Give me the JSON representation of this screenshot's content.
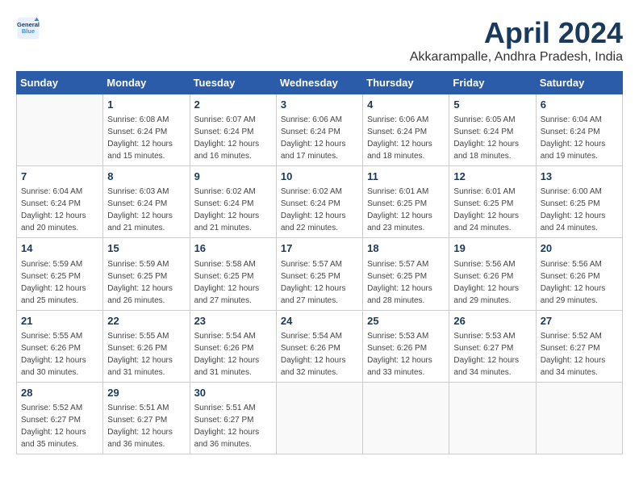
{
  "header": {
    "logo_line1": "General",
    "logo_line2": "Blue",
    "month_title": "April 2024",
    "subtitle": "Akkarampalle, Andhra Pradesh, India"
  },
  "weekdays": [
    "Sunday",
    "Monday",
    "Tuesday",
    "Wednesday",
    "Thursday",
    "Friday",
    "Saturday"
  ],
  "weeks": [
    [
      {
        "day": "",
        "sunrise": "",
        "sunset": "",
        "daylight": ""
      },
      {
        "day": "1",
        "sunrise": "Sunrise: 6:08 AM",
        "sunset": "Sunset: 6:24 PM",
        "daylight": "Daylight: 12 hours and 15 minutes."
      },
      {
        "day": "2",
        "sunrise": "Sunrise: 6:07 AM",
        "sunset": "Sunset: 6:24 PM",
        "daylight": "Daylight: 12 hours and 16 minutes."
      },
      {
        "day": "3",
        "sunrise": "Sunrise: 6:06 AM",
        "sunset": "Sunset: 6:24 PM",
        "daylight": "Daylight: 12 hours and 17 minutes."
      },
      {
        "day": "4",
        "sunrise": "Sunrise: 6:06 AM",
        "sunset": "Sunset: 6:24 PM",
        "daylight": "Daylight: 12 hours and 18 minutes."
      },
      {
        "day": "5",
        "sunrise": "Sunrise: 6:05 AM",
        "sunset": "Sunset: 6:24 PM",
        "daylight": "Daylight: 12 hours and 18 minutes."
      },
      {
        "day": "6",
        "sunrise": "Sunrise: 6:04 AM",
        "sunset": "Sunset: 6:24 PM",
        "daylight": "Daylight: 12 hours and 19 minutes."
      }
    ],
    [
      {
        "day": "7",
        "sunrise": "Sunrise: 6:04 AM",
        "sunset": "Sunset: 6:24 PM",
        "daylight": "Daylight: 12 hours and 20 minutes."
      },
      {
        "day": "8",
        "sunrise": "Sunrise: 6:03 AM",
        "sunset": "Sunset: 6:24 PM",
        "daylight": "Daylight: 12 hours and 21 minutes."
      },
      {
        "day": "9",
        "sunrise": "Sunrise: 6:02 AM",
        "sunset": "Sunset: 6:24 PM",
        "daylight": "Daylight: 12 hours and 21 minutes."
      },
      {
        "day": "10",
        "sunrise": "Sunrise: 6:02 AM",
        "sunset": "Sunset: 6:24 PM",
        "daylight": "Daylight: 12 hours and 22 minutes."
      },
      {
        "day": "11",
        "sunrise": "Sunrise: 6:01 AM",
        "sunset": "Sunset: 6:25 PM",
        "daylight": "Daylight: 12 hours and 23 minutes."
      },
      {
        "day": "12",
        "sunrise": "Sunrise: 6:01 AM",
        "sunset": "Sunset: 6:25 PM",
        "daylight": "Daylight: 12 hours and 24 minutes."
      },
      {
        "day": "13",
        "sunrise": "Sunrise: 6:00 AM",
        "sunset": "Sunset: 6:25 PM",
        "daylight": "Daylight: 12 hours and 24 minutes."
      }
    ],
    [
      {
        "day": "14",
        "sunrise": "Sunrise: 5:59 AM",
        "sunset": "Sunset: 6:25 PM",
        "daylight": "Daylight: 12 hours and 25 minutes."
      },
      {
        "day": "15",
        "sunrise": "Sunrise: 5:59 AM",
        "sunset": "Sunset: 6:25 PM",
        "daylight": "Daylight: 12 hours and 26 minutes."
      },
      {
        "day": "16",
        "sunrise": "Sunrise: 5:58 AM",
        "sunset": "Sunset: 6:25 PM",
        "daylight": "Daylight: 12 hours and 27 minutes."
      },
      {
        "day": "17",
        "sunrise": "Sunrise: 5:57 AM",
        "sunset": "Sunset: 6:25 PM",
        "daylight": "Daylight: 12 hours and 27 minutes."
      },
      {
        "day": "18",
        "sunrise": "Sunrise: 5:57 AM",
        "sunset": "Sunset: 6:25 PM",
        "daylight": "Daylight: 12 hours and 28 minutes."
      },
      {
        "day": "19",
        "sunrise": "Sunrise: 5:56 AM",
        "sunset": "Sunset: 6:26 PM",
        "daylight": "Daylight: 12 hours and 29 minutes."
      },
      {
        "day": "20",
        "sunrise": "Sunrise: 5:56 AM",
        "sunset": "Sunset: 6:26 PM",
        "daylight": "Daylight: 12 hours and 29 minutes."
      }
    ],
    [
      {
        "day": "21",
        "sunrise": "Sunrise: 5:55 AM",
        "sunset": "Sunset: 6:26 PM",
        "daylight": "Daylight: 12 hours and 30 minutes."
      },
      {
        "day": "22",
        "sunrise": "Sunrise: 5:55 AM",
        "sunset": "Sunset: 6:26 PM",
        "daylight": "Daylight: 12 hours and 31 minutes."
      },
      {
        "day": "23",
        "sunrise": "Sunrise: 5:54 AM",
        "sunset": "Sunset: 6:26 PM",
        "daylight": "Daylight: 12 hours and 31 minutes."
      },
      {
        "day": "24",
        "sunrise": "Sunrise: 5:54 AM",
        "sunset": "Sunset: 6:26 PM",
        "daylight": "Daylight: 12 hours and 32 minutes."
      },
      {
        "day": "25",
        "sunrise": "Sunrise: 5:53 AM",
        "sunset": "Sunset: 6:26 PM",
        "daylight": "Daylight: 12 hours and 33 minutes."
      },
      {
        "day": "26",
        "sunrise": "Sunrise: 5:53 AM",
        "sunset": "Sunset: 6:27 PM",
        "daylight": "Daylight: 12 hours and 34 minutes."
      },
      {
        "day": "27",
        "sunrise": "Sunrise: 5:52 AM",
        "sunset": "Sunset: 6:27 PM",
        "daylight": "Daylight: 12 hours and 34 minutes."
      }
    ],
    [
      {
        "day": "28",
        "sunrise": "Sunrise: 5:52 AM",
        "sunset": "Sunset: 6:27 PM",
        "daylight": "Daylight: 12 hours and 35 minutes."
      },
      {
        "day": "29",
        "sunrise": "Sunrise: 5:51 AM",
        "sunset": "Sunset: 6:27 PM",
        "daylight": "Daylight: 12 hours and 36 minutes."
      },
      {
        "day": "30",
        "sunrise": "Sunrise: 5:51 AM",
        "sunset": "Sunset: 6:27 PM",
        "daylight": "Daylight: 12 hours and 36 minutes."
      },
      {
        "day": "",
        "sunrise": "",
        "sunset": "",
        "daylight": ""
      },
      {
        "day": "",
        "sunrise": "",
        "sunset": "",
        "daylight": ""
      },
      {
        "day": "",
        "sunrise": "",
        "sunset": "",
        "daylight": ""
      },
      {
        "day": "",
        "sunrise": "",
        "sunset": "",
        "daylight": ""
      }
    ]
  ]
}
